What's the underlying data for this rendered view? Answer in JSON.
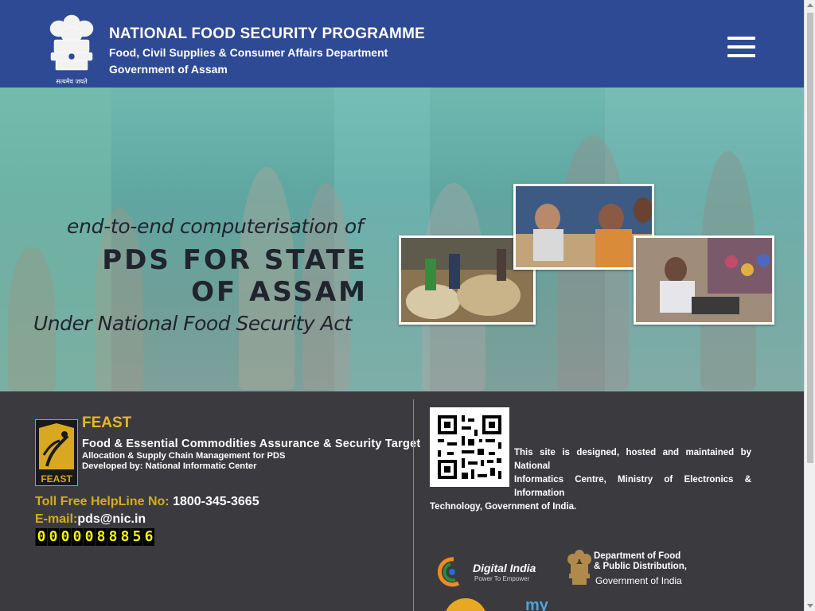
{
  "header": {
    "title": "NATIONAL FOOD SECURITY PROGRAMME",
    "department": "Food, Civil Supplies & Consumer Affairs Department",
    "government": "Government of Assam",
    "emblem_caption": "सत्यमेव जयते",
    "menu_icon": "hamburger-menu-icon",
    "bg_color": "#2f4a94"
  },
  "banner": {
    "line1": "end-to-end computerisation of",
    "line2": "PDS FOR STATE",
    "line3": "OF ASSAM",
    "line4": "Under National Food Security Act"
  },
  "footer": {
    "feast": {
      "title": "FEAST",
      "logo_text": "FEAST",
      "full_name": "Food & Essential Commodities Assurance & Security Target",
      "subtitle": "Allocation & Supply Chain Management for PDS",
      "developer": "Developed by: National Informatic Center"
    },
    "helpline_label": "Toll Free HelpLine No:",
    "helpline_number": "1800-345-3665",
    "email_label": "E-mail:",
    "email_value": "pds@nic.in",
    "visitor_counter": "0000088856",
    "site_info_l1": "This site is designed, hosted and maintained by National",
    "site_info_l2": "Informatics Centre, Ministry of Electronics & Information",
    "site_info_l3": "Technology, Government of India.",
    "digital_india": {
      "name": "Digital India",
      "tagline": "Power To Empower"
    },
    "dept_food": {
      "line1": "Department of Food",
      "line2": "& Public Distribution,",
      "line3": "Government of India"
    },
    "mygov_text": "my"
  },
  "colors": {
    "accent_gold": "#d4ad1e",
    "footer_bg": "#3b3b3f",
    "counter_digit": "#f7f200"
  }
}
